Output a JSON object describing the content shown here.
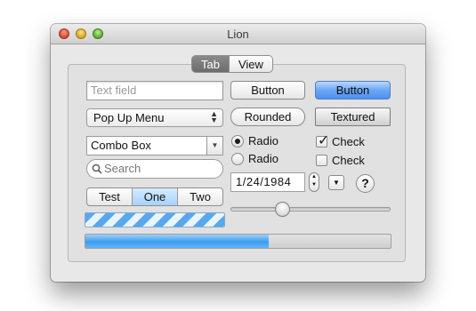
{
  "window": {
    "title": "Lion"
  },
  "tabs": [
    {
      "label": "Tab",
      "selected": true
    },
    {
      "label": "View",
      "selected": false
    }
  ],
  "left": {
    "text_field_placeholder": "Text field",
    "popup_value": "Pop Up Menu",
    "combo_value": "Combo Box",
    "search_placeholder": "Search",
    "segments": [
      {
        "label": "Test",
        "selected": false
      },
      {
        "label": "One",
        "selected": true
      },
      {
        "label": "Two",
        "selected": false
      }
    ],
    "progress_fraction": 0.6
  },
  "right": {
    "button_label": "Button",
    "default_button_label": "Button",
    "rounded_label": "Rounded",
    "textured_label": "Textured",
    "radios": [
      {
        "label": "Radio",
        "checked": true
      },
      {
        "label": "Radio",
        "checked": false
      }
    ],
    "checks": [
      {
        "label": "Check",
        "checked": true
      },
      {
        "label": "Check",
        "checked": false
      }
    ],
    "date_value": "1/24/1984",
    "help_label": "?",
    "slider_value": 0.3
  },
  "icons": {
    "search": "magnifier-icon",
    "popup_arrows": "updown-chevron-icon",
    "combo_arrow": "chevron-down-icon",
    "disclosure": "triangle-down-icon"
  },
  "colors": {
    "accent": "#4e90ee",
    "selection": "#a6d2fb"
  }
}
